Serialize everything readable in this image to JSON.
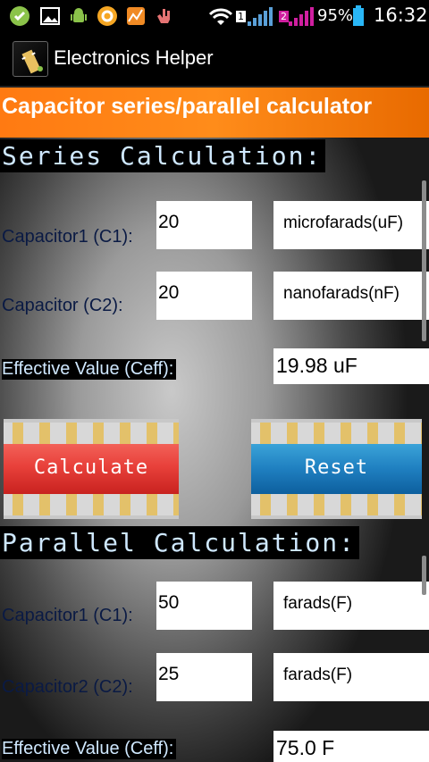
{
  "status_bar": {
    "battery_percent": "95%",
    "time": "16:32",
    "sim1_label": "1",
    "sim2_label": "2"
  },
  "action_bar": {
    "title": "Electronics Helper"
  },
  "header": {
    "title": "Capacitor series/parallel calculator"
  },
  "series": {
    "title": "Series Calculation:",
    "c1_label": "Capacitor1 (C1):",
    "c1_value": "20",
    "c1_unit": "microfarads(uF)",
    "c2_label": "Capacitor (C2):",
    "c2_value": "20",
    "c2_unit": "nanofarads(nF)",
    "result_label": "Effective Value (Ceff):",
    "result_value": "19.98 uF"
  },
  "buttons": {
    "calculate": "Calculate",
    "reset": "Reset"
  },
  "parallel": {
    "title": "Parallel Calculation:",
    "c1_label": "Capacitor1 (C1):",
    "c1_value": "50",
    "c1_unit": "farads(F)",
    "c2_label": "Capacitor2 (C2):",
    "c2_value": "25",
    "c2_unit": "farads(F)",
    "result_label": "Effective Value (Ceff):",
    "result_value": "75.0 F"
  },
  "colors": {
    "header_orange": "#ff8c1a",
    "calculate_red": "#e8403a",
    "reset_blue": "#1f7fc0",
    "battery_cyan": "#29b6f6",
    "signal_magenta": "#d01fa0"
  }
}
